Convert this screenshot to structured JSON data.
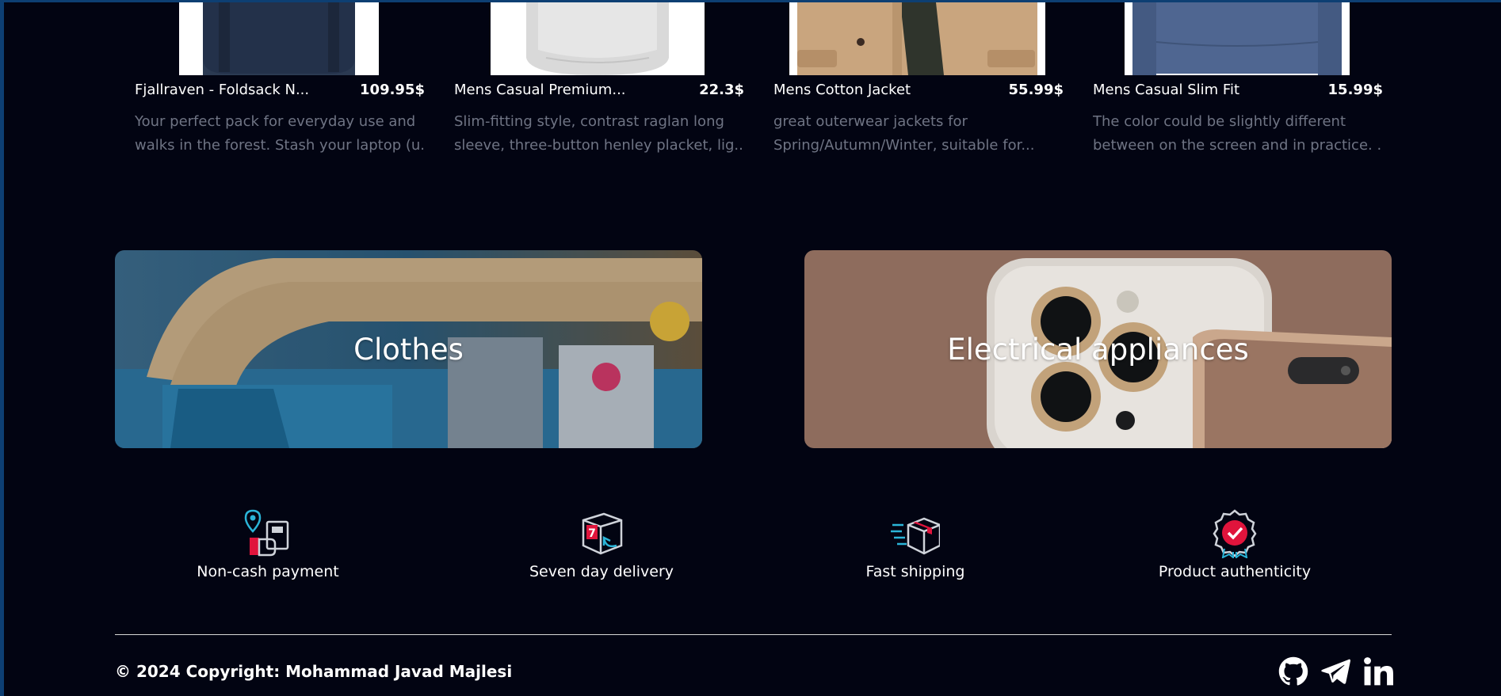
{
  "products": [
    {
      "title": "Fjallraven - Foldsack N...",
      "price": "109.95$",
      "desc_lines": [
        "Your perfect pack for everyday use and",
        "walks in the forest. Stash your laptop (u..."
      ]
    },
    {
      "title": "Mens Casual Premium...",
      "price": "22.3$",
      "desc_lines": [
        "Slim-fitting style, contrast raglan long",
        "sleeve, three-button henley placket, lig..."
      ]
    },
    {
      "title": "Mens Cotton Jacket",
      "price": "55.99$",
      "desc_lines": [
        "great outerwear jackets for",
        "Spring/Autumn/Winter, suitable for..."
      ]
    },
    {
      "title": "Mens Casual Slim Fit",
      "price": "15.99$",
      "desc_lines": [
        "The color could be slightly different",
        "between on the screen and in practice. ..."
      ]
    }
  ],
  "categories": [
    {
      "label": "Clothes"
    },
    {
      "label": "Electrical appliances"
    }
  ],
  "features": [
    {
      "label": "Non-cash payment",
      "icon": "payment-icon"
    },
    {
      "label": "Seven day delivery",
      "icon": "seven-day-box-icon"
    },
    {
      "label": "Fast shipping",
      "icon": "fast-shipping-box-icon"
    },
    {
      "label": "Product authenticity",
      "icon": "authenticity-badge-icon"
    }
  ],
  "footer": {
    "copyright": "© 2024 Copyright: Mohammad Javad Majlesi",
    "social": [
      "github-icon",
      "telegram-icon",
      "linkedin-icon"
    ]
  },
  "colors": {
    "background": "#020412",
    "frame": "#0d3f73",
    "muted_text": "#6f7484",
    "accent_red": "#e0143c",
    "accent_cyan": "#2bb5d8"
  }
}
